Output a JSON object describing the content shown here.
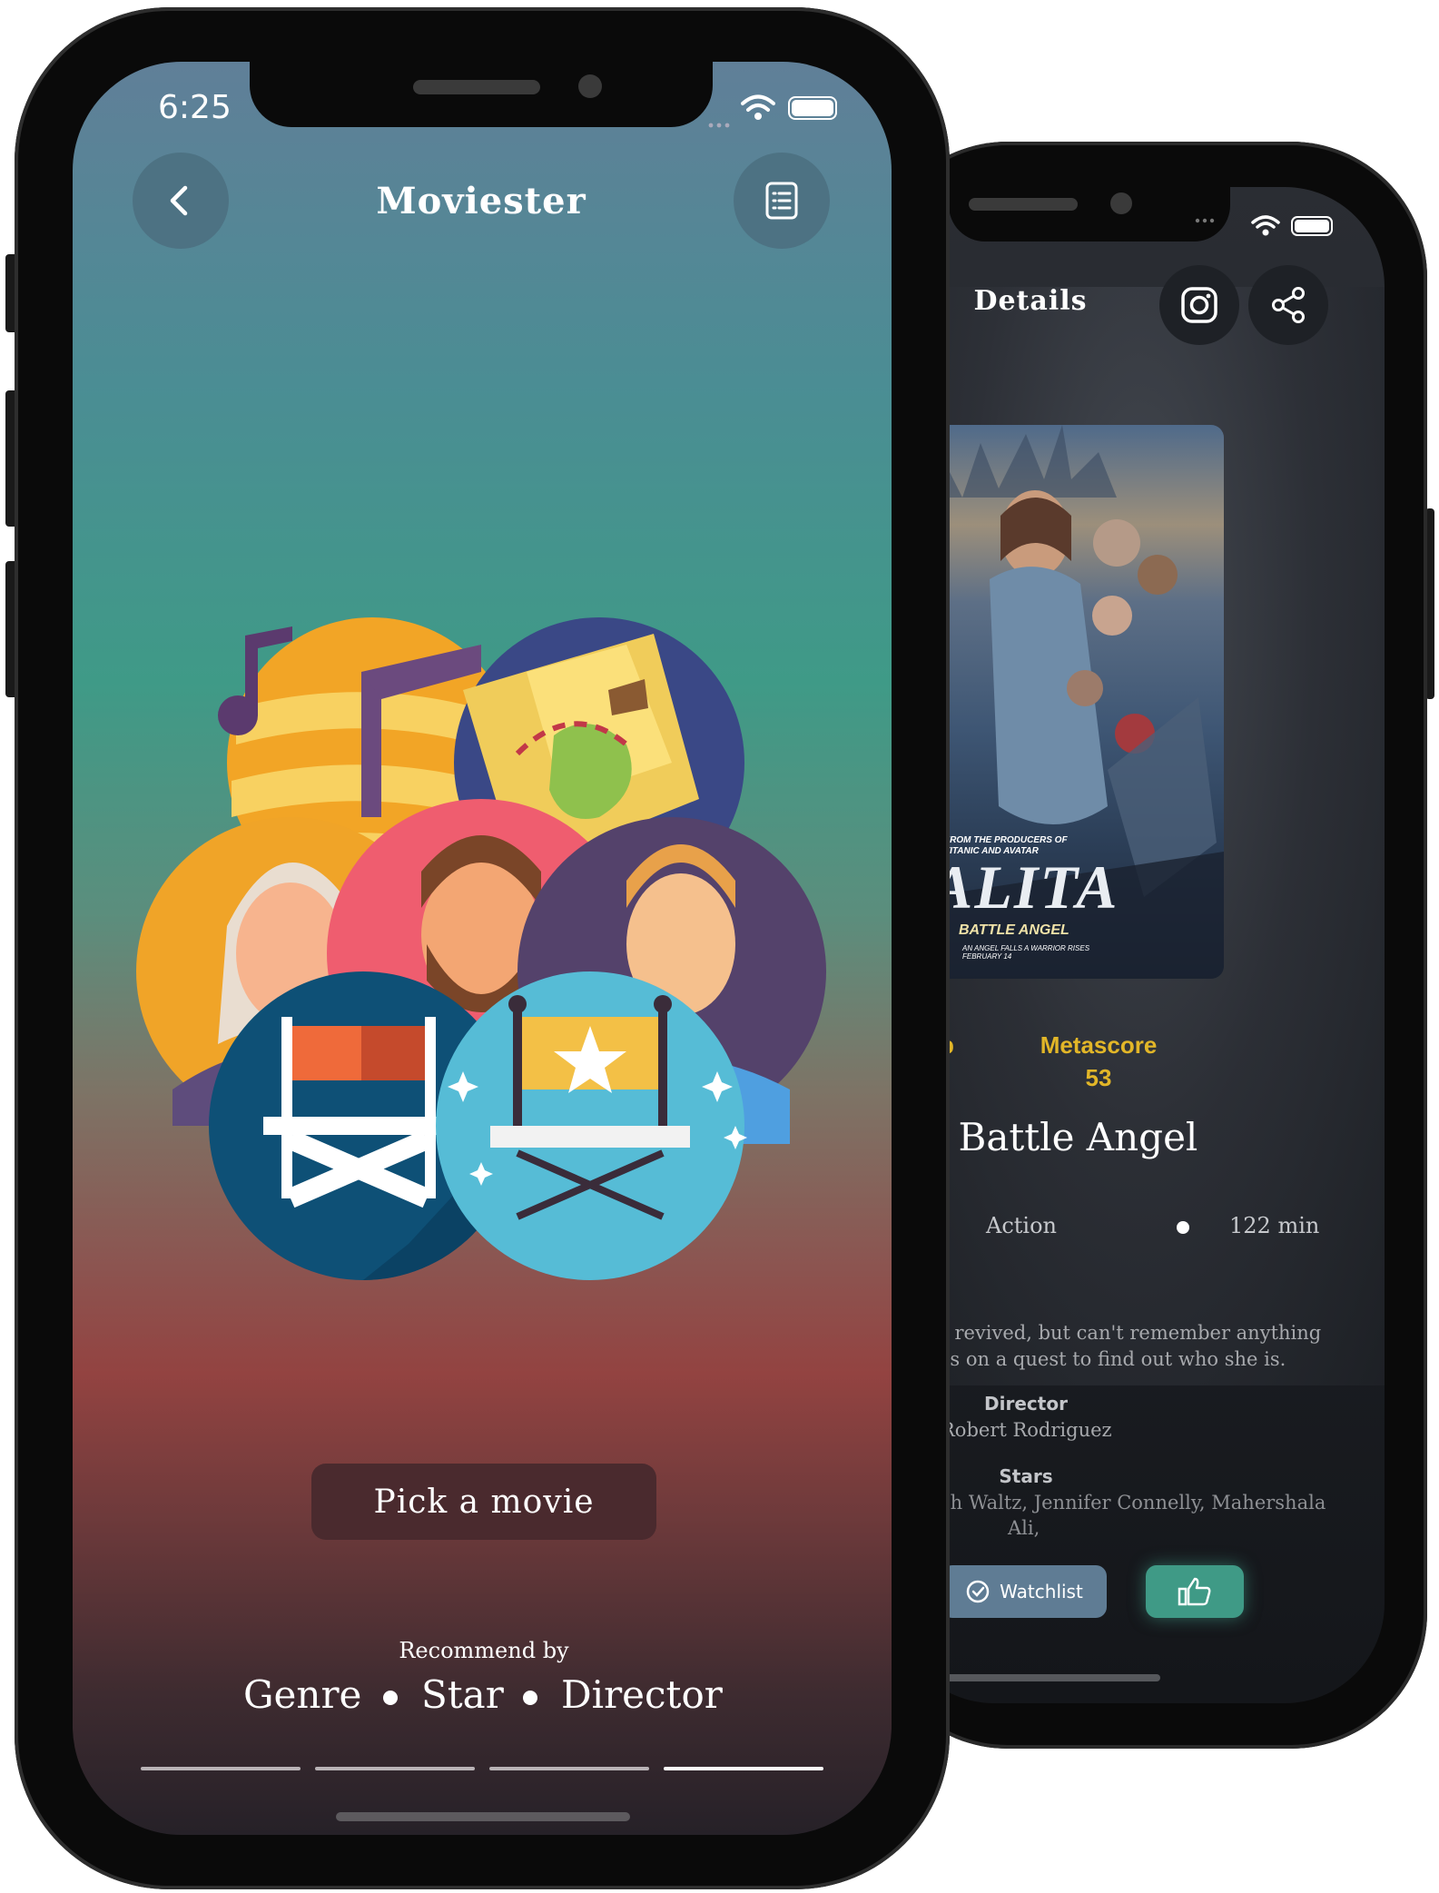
{
  "front": {
    "status_time": "6:25",
    "app_title": "Moviester",
    "pick_button": "Pick a movie",
    "recommend_label": "Recommend by",
    "recommend_options": [
      "Genre",
      "Star",
      "Director"
    ],
    "progress_active_index": 3
  },
  "back": {
    "header_title": "Details",
    "poster": {
      "tagline": "FROM THE PRODUCERS OF TITANIC AND AVATAR",
      "title_art": "ALITA",
      "subtitle_art": "BATTLE ANGEL",
      "release_text": "AN ANGEL FALLS A WARRIOR RISES FEBRUARY 14"
    },
    "rating_label_partial": "b",
    "metascore_label": "Metascore",
    "metascore_value": "53",
    "movie_title_partial": ": Battle Angel",
    "genre": "Action",
    "runtime": "122 min",
    "plot_line1": "s revived, but can't remember anything",
    "plot_line2": "es on a quest to find out who she is.",
    "director_label": "Director",
    "director_value": "Robert Rodriguez",
    "stars_label": "Stars",
    "stars_line1": "oh Waltz, Jennifer Connelly, Mahershala",
    "stars_line2": "Ali,",
    "watchlist_label": "Watchlist"
  },
  "colors": {
    "accent_yellow": "#e2b628",
    "like_green": "#3f9a86",
    "watchlist_blue": "#5f7c94"
  },
  "icons": {
    "back": "chevron-left-icon",
    "list": "list-icon",
    "instagram": "instagram-icon",
    "share": "share-icon",
    "watchlist": "check-circle-icon",
    "like": "thumbs-up-icon"
  }
}
